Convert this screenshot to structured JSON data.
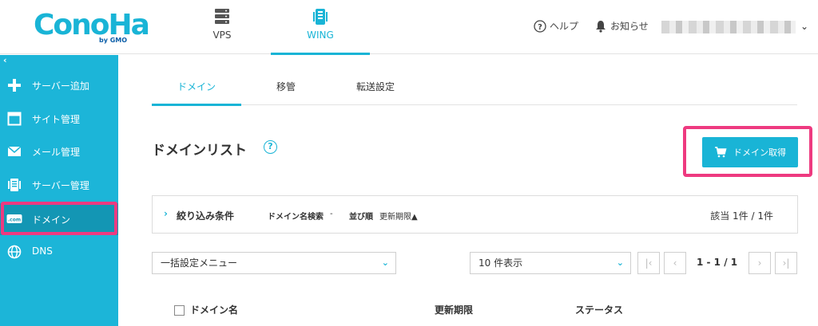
{
  "header": {
    "logo_text": "ConoHa",
    "logo_sub": "by GMO",
    "tabs": [
      {
        "label": "VPS",
        "icon": "server-stack-icon"
      },
      {
        "label": "WING",
        "icon": "server-wing-icon"
      }
    ],
    "help_label": "ヘルプ",
    "notice_label": "お知らせ"
  },
  "sidebar": {
    "collapse": "‹",
    "items": [
      {
        "label": "サーバー追加",
        "icon": "plus-icon"
      },
      {
        "label": "サイト管理",
        "icon": "window-icon"
      },
      {
        "label": "メール管理",
        "icon": "mail-icon"
      },
      {
        "label": "サーバー管理",
        "icon": "server-icon"
      },
      {
        "label": "ドメイン",
        "icon": "domain-com-icon"
      },
      {
        "label": "DNS",
        "icon": "globe-icon"
      }
    ],
    "active_index": 4
  },
  "subtabs": [
    "ドメイン",
    "移管",
    "転送設定"
  ],
  "page": {
    "title": "ドメインリスト",
    "help": "?",
    "get_button": "ドメイン取得"
  },
  "filter": {
    "title": "絞り込み条件",
    "domain_search_label": "ドメイン名検索",
    "domain_search_value": "-",
    "sort_label": "並び順",
    "sort_value": "更新期限▲",
    "count": "該当 1件 / 1件"
  },
  "controls": {
    "bulk_menu": "一括設定メニュー",
    "per_page": "10 件表示",
    "page_info": "1 - 1 / 1"
  },
  "table": {
    "columns": [
      "ドメイン名",
      "更新期限",
      "ステータス"
    ]
  },
  "colors": {
    "accent": "#19b4d6",
    "highlight": "#ee3a80"
  }
}
